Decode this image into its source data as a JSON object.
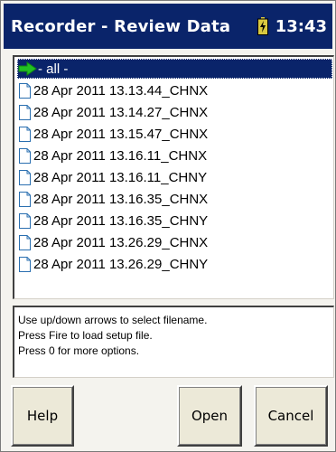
{
  "window": {
    "title": "Recorder - Review Data",
    "clock": "13:43",
    "battery_icon": "battery-charging-icon"
  },
  "file_list": {
    "items": [
      {
        "label": "- all -",
        "icon": "arrow-right-icon",
        "selected": true
      },
      {
        "label": "28 Apr 2011 13.13.44_CHNX",
        "icon": "file-icon",
        "selected": false
      },
      {
        "label": "28 Apr 2011 13.14.27_CHNX",
        "icon": "file-icon",
        "selected": false
      },
      {
        "label": "28 Apr 2011 13.15.47_CHNX",
        "icon": "file-icon",
        "selected": false
      },
      {
        "label": "28 Apr 2011 13.16.11_CHNX",
        "icon": "file-icon",
        "selected": false
      },
      {
        "label": "28 Apr 2011 13.16.11_CHNY",
        "icon": "file-icon",
        "selected": false
      },
      {
        "label": "28 Apr 2011 13.16.35_CHNX",
        "icon": "file-icon",
        "selected": false
      },
      {
        "label": "28 Apr 2011 13.16.35_CHNY",
        "icon": "file-icon",
        "selected": false
      },
      {
        "label": "28 Apr 2011 13.26.29_CHNX",
        "icon": "file-icon",
        "selected": false
      },
      {
        "label": "28 Apr 2011 13.26.29_CHNY",
        "icon": "file-icon",
        "selected": false
      }
    ]
  },
  "instructions": {
    "lines": [
      "Use up/down arrows to select filename.",
      "Press Fire to load setup file.",
      "Press 0 for more options."
    ]
  },
  "buttons": {
    "help": "Help",
    "open": "Open",
    "cancel": "Cancel"
  },
  "colors": {
    "title_bar": "#0a246a",
    "selection": "#0a246a",
    "arrow_icon": "#22c022",
    "button_face": "#ece9d8"
  }
}
